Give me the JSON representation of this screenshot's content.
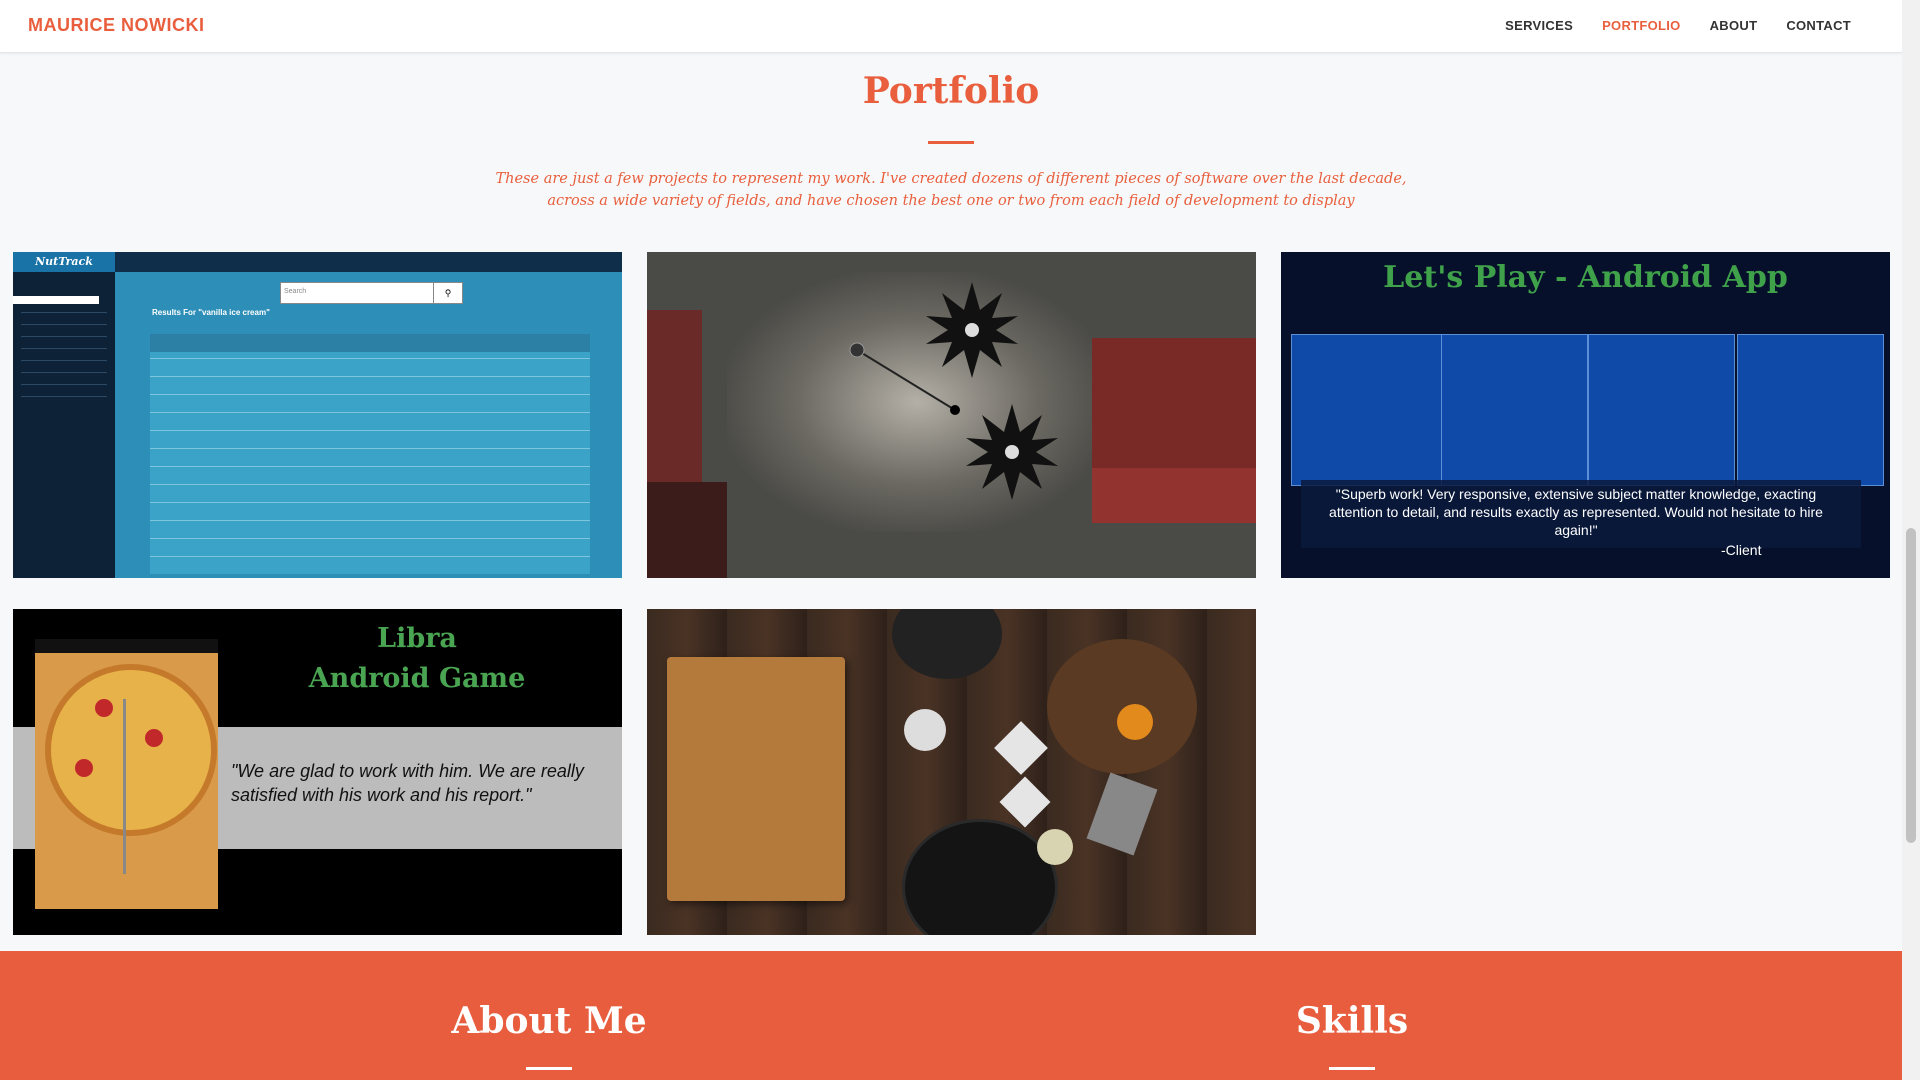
{
  "brand": "MAURICE NOWICKI",
  "nav": {
    "services": "SERVICES",
    "portfolio": "PORTFOLIO",
    "about": "ABOUT",
    "contact": "CONTACT",
    "active": "portfolio"
  },
  "portfolio": {
    "title": "Portfolio",
    "description": "These are just a few projects to represent my work. I've created dozens of different pieces of software over the last decade, across a wide variety of fields, and have chosen the best one or two from each field of development to display",
    "items": [
      {
        "app_logo": "NutTrack",
        "results_heading": "Results For \"vanilla ice cream\"",
        "search_placeholder": "Search"
      },
      {},
      {
        "heading": "Let's Play - Android App",
        "quote": "\"Superb work! Very responsive, extensive subject matter knowledge, exacting attention to detail, and results exactly as represented. Would not hesitate to hire again!\"",
        "attribution": "-Client"
      },
      {
        "heading_line1": "Libra",
        "heading_line2": "Android Game",
        "quote": "\"We are glad to work with him. We are really satisfied with his work and his report.\""
      },
      {}
    ]
  },
  "about": {
    "title": "About Me",
    "skills_title": "Skills"
  },
  "colors": {
    "accent": "#e95f3e",
    "band": "#e75d3e"
  }
}
